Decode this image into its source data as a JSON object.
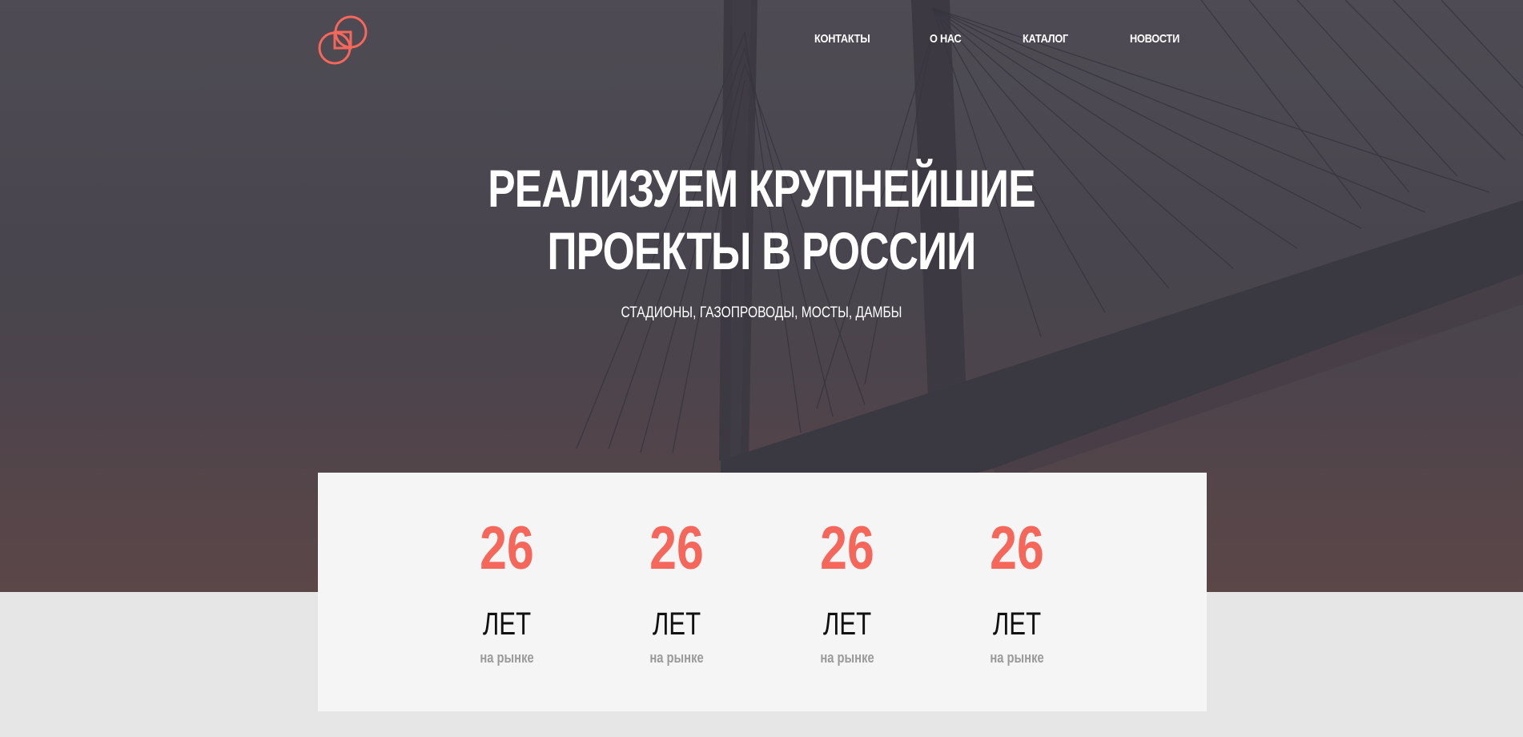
{
  "brand": {
    "logo_icon": "linked-squares-circles-logo",
    "accent_color": "#f4675a"
  },
  "nav": {
    "items": [
      {
        "label": "КОНТАКТЫ"
      },
      {
        "label": "О НАС"
      },
      {
        "label": "КАТАЛОГ"
      },
      {
        "label": "НОВОСТИ"
      }
    ]
  },
  "hero": {
    "title_line1": "РЕАЛИЗУЕМ КРУПНЕЙШИЕ",
    "title_line2": "ПРОЕКТЫ В РОССИИ",
    "subtitle": "СТАДИОНЫ, ГАЗОПРОВОДЫ, МОСТЫ, ДАМБЫ",
    "background": "cable-stayed-bridge-photo"
  },
  "stats": {
    "items": [
      {
        "value": "26",
        "label": "ЛЕТ",
        "sub": "на рынке"
      },
      {
        "value": "26",
        "label": "ЛЕТ",
        "sub": "на рынке"
      },
      {
        "value": "26",
        "label": "ЛЕТ",
        "sub": "на рынке"
      },
      {
        "value": "26",
        "label": "ЛЕТ",
        "sub": "на рынке"
      }
    ]
  }
}
